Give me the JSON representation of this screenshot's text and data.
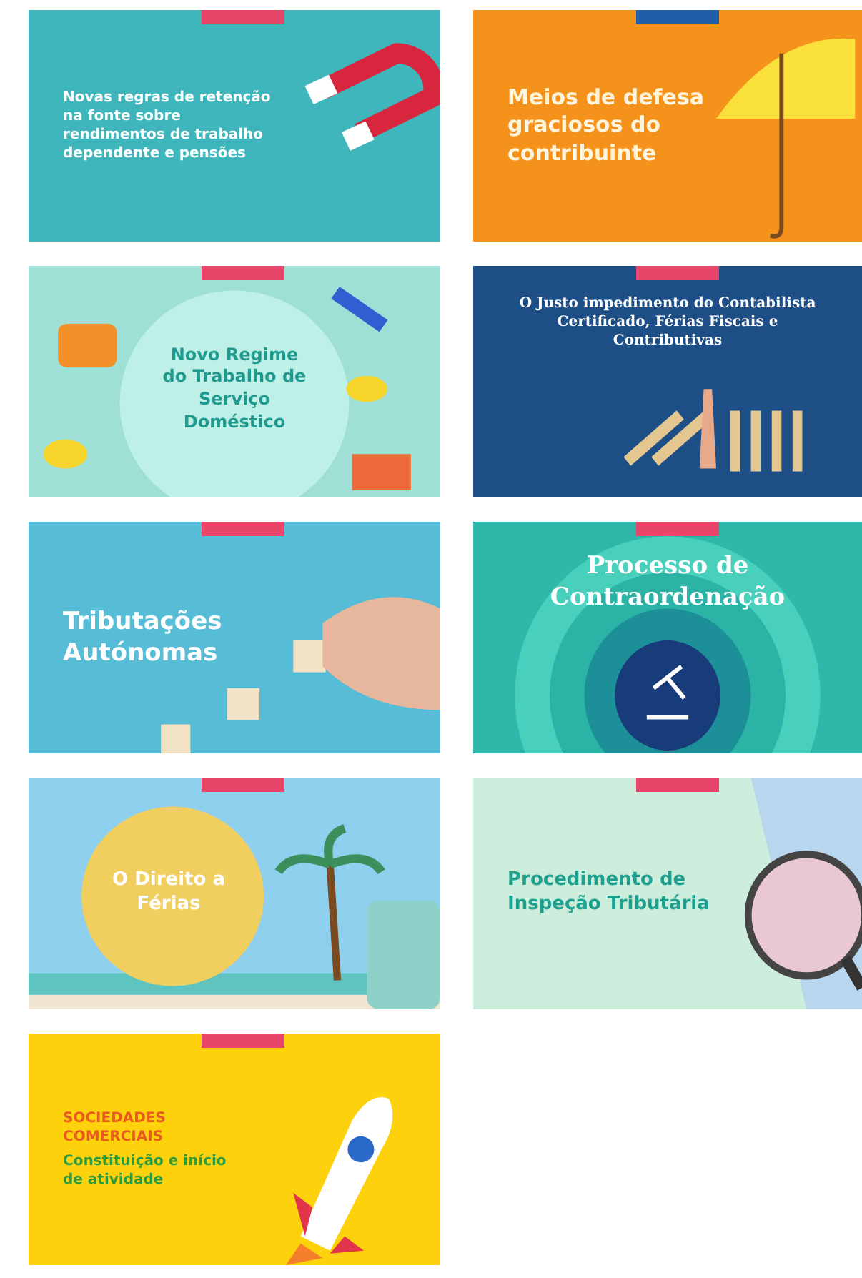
{
  "cards": [
    {
      "kind": "magnet",
      "title": "Novas regras de retenção na fonte sobre rendimentos de trabalho dependente e pensões"
    },
    {
      "kind": "umbrella",
      "title": "Meios de defesa graciosos do contribuinte"
    },
    {
      "kind": "cleaning",
      "title": "Novo Regime do Trabalho de Serviço Doméstico"
    },
    {
      "kind": "dominoes",
      "title": "O Justo impedimento do Contabilista Certificado, Férias Fiscais e Contributivas"
    },
    {
      "kind": "blocks",
      "title": "Tributações Autónomas"
    },
    {
      "kind": "rings",
      "title": "Processo de Contraordenação"
    },
    {
      "kind": "beach",
      "title": "O Direito a Férias"
    },
    {
      "kind": "magnifier",
      "title": "Procedimento de Inspeção Tributária"
    },
    {
      "kind": "rocket",
      "title": "SOCIEDADES COMERCIAIS",
      "subtitle": "Constituição e início de atividade"
    }
  ]
}
